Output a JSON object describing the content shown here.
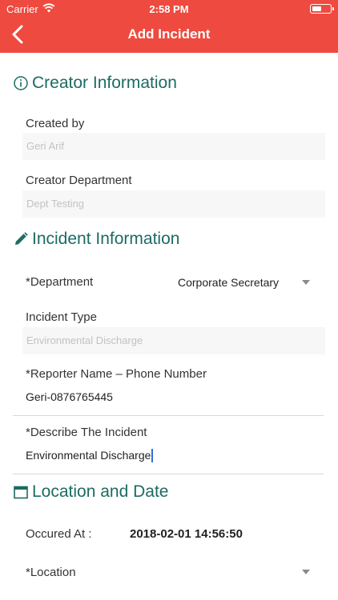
{
  "status_bar": {
    "carrier": "Carrier",
    "time": "2:58 PM"
  },
  "nav": {
    "title": "Add Incident"
  },
  "creator_section": {
    "title": "Creator Information",
    "created_by_label": "Created by",
    "created_by_value": "Geri Arif",
    "department_label": "Creator Department",
    "department_value": "Dept Testing"
  },
  "incident_section": {
    "title": "Incident Information",
    "department_label": "*Department",
    "department_value": "Corporate Secretary",
    "type_label": "Incident Type",
    "type_value": "Environmental Discharge",
    "reporter_label": "*Reporter Name – Phone Number",
    "reporter_value": "Geri-0876765445",
    "describe_label": "*Describe The Incident",
    "describe_value": "Environmental Discharge"
  },
  "location_section": {
    "title": "Location and Date",
    "occured_label": "Occured At :",
    "occured_value": "2018-02-01 14:56:50",
    "location_label": "*Location"
  },
  "icons": {
    "back": "chevron-left-icon",
    "info": "info-circle-icon",
    "pencil": "pencil-icon",
    "calendar": "calendar-icon",
    "dropdown": "caret-down-icon"
  },
  "colors": {
    "nav_bg": "#ef4a3f",
    "section_title": "#1d6b63",
    "cursor": "#2f6fde"
  }
}
